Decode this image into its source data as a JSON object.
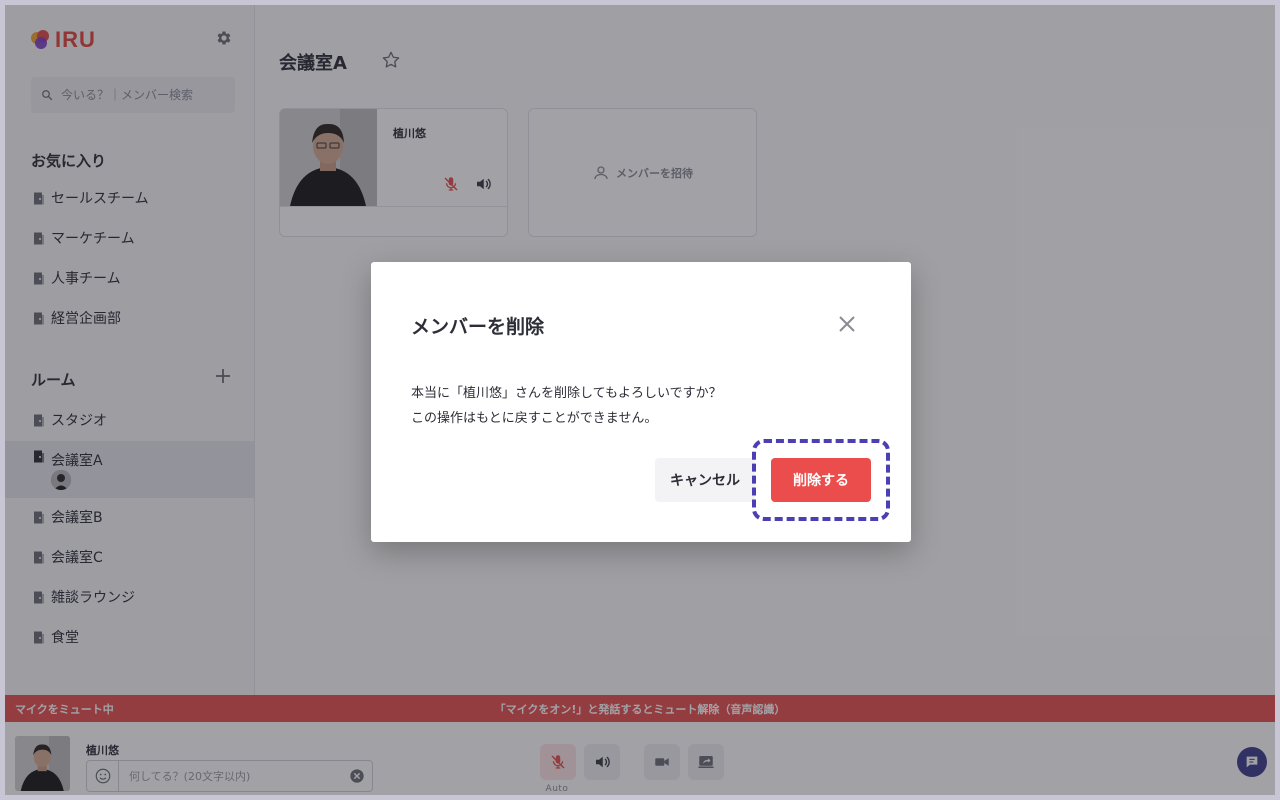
{
  "app": {
    "logo_text": "IRU",
    "brand_color": "#e1473f",
    "accent_color": "#4c3fb3"
  },
  "sidebar": {
    "search_placeholder": "今いる？｜メンバー検索",
    "favorites_title": "お気に入り",
    "favorites": [
      {
        "label": "セールスチーム"
      },
      {
        "label": "マーケチーム"
      },
      {
        "label": "人事チーム"
      },
      {
        "label": "経営企画部"
      }
    ],
    "rooms_title": "ルーム",
    "rooms": [
      {
        "label": "スタジオ"
      },
      {
        "label": "会議室A",
        "active": true
      },
      {
        "label": "会議室B"
      },
      {
        "label": "会議室C"
      },
      {
        "label": "雑談ラウンジ"
      },
      {
        "label": "食堂"
      }
    ]
  },
  "main": {
    "room_title": "会議室A",
    "member": {
      "name": "植川悠"
    },
    "invite_label": "メンバーを招待"
  },
  "mute_bar": {
    "left": "マイクをミュート中",
    "center": "「マイクをオン!」と発話するとミュート解除（音声認識）",
    "color": "#e65151"
  },
  "bottom": {
    "user_name": "植川悠",
    "status_placeholder": "何してる？(20文字以内)",
    "auto_label": "Auto"
  },
  "modal": {
    "title": "メンバーを削除",
    "message_line1": "本当に「植川悠」さんを削除してもよろしいですか？",
    "message_line2": "この操作はもとに戻すことができません。",
    "cancel_label": "キャンセル",
    "delete_label": "削除する",
    "delete_color": "#eb4d4d"
  }
}
